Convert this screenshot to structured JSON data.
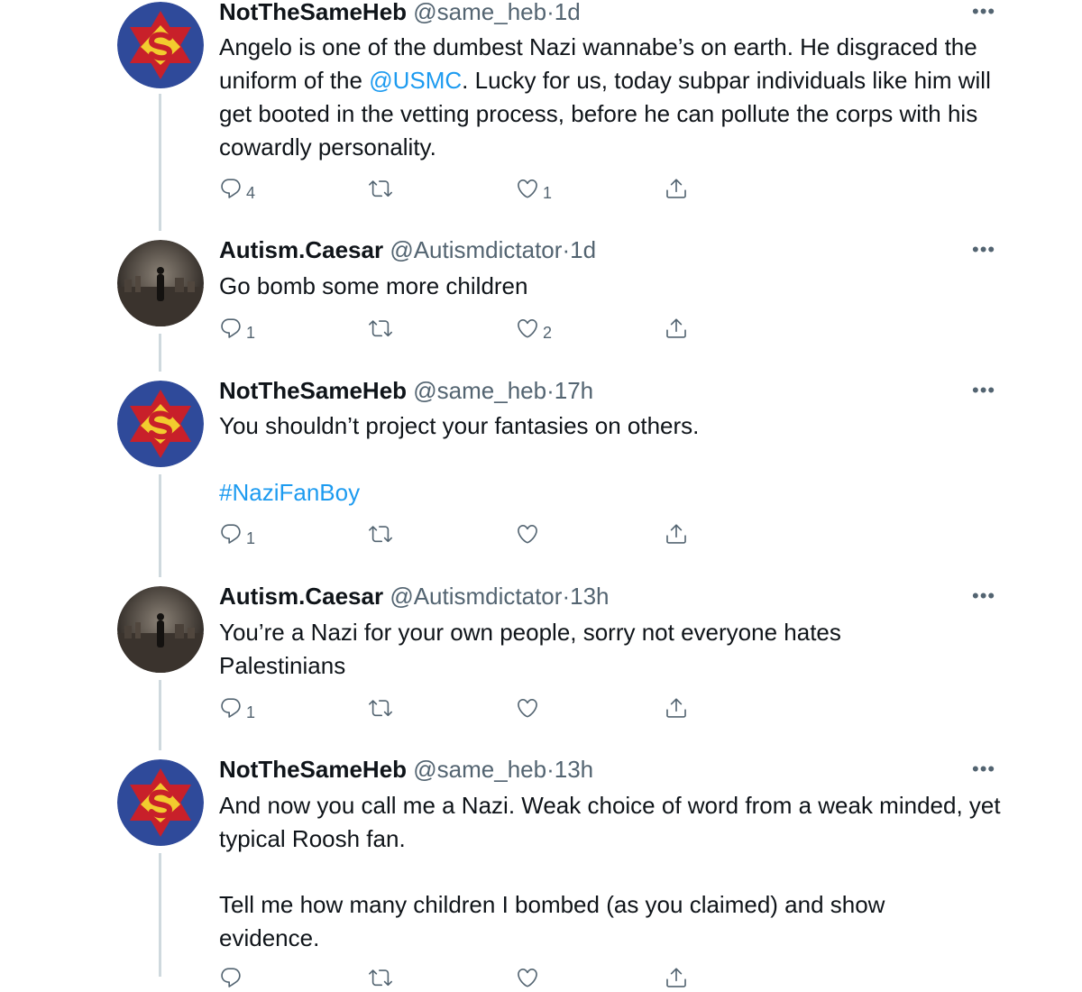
{
  "colors": {
    "link": "#1d9bf0",
    "secondary": "#536471",
    "thread_line": "#cfd9de"
  },
  "tweets": [
    {
      "name": "NotTheSameHeb",
      "handle": "@same_heb",
      "dot": "·",
      "time": "1d",
      "avatar": "superman-star-avatar",
      "text_parts": {
        "a": "Angelo is one of the dumbest Nazi wannabe’s on earth. He disgraced the uniform of the ",
        "mention": "@USMC",
        "b": ". Lucky for us, today subpar individuals like him will get booted in the vetting process, before he can pollute the corps with his cowardly personality."
      },
      "replies": "4",
      "retweets": "",
      "likes": "1"
    },
    {
      "name": "Autism.Caesar",
      "handle": "@Autismdictator",
      "dot": "·",
      "time": "1d",
      "avatar": "city-silhouette-avatar",
      "text": "Go bomb some more children",
      "replies": "1",
      "retweets": "",
      "likes": "2"
    },
    {
      "name": "NotTheSameHeb",
      "handle": "@same_heb",
      "dot": "·",
      "time": "17h",
      "avatar": "superman-star-avatar",
      "text": "You shouldn’t project your fantasies on others.",
      "hashtag": "#NaziFanBoy",
      "replies": "1",
      "retweets": "",
      "likes": ""
    },
    {
      "name": "Autism.Caesar",
      "handle": "@Autismdictator",
      "dot": "·",
      "time": "13h",
      "avatar": "city-silhouette-avatar",
      "text": "You’re a Nazi for your own people, sorry not everyone hates Palestinians",
      "replies": "1",
      "retweets": "",
      "likes": ""
    },
    {
      "name": "NotTheSameHeb",
      "handle": "@same_heb",
      "dot": "·",
      "time": "13h",
      "avatar": "superman-star-avatar",
      "text": "And now you call me a Nazi. Weak choice of word from a weak minded, yet typical Roosh fan.",
      "text2": "Tell me how many children I bombed (as you claimed) and show evidence.",
      "replies": "",
      "retweets": "",
      "likes": ""
    }
  ],
  "more_glyph": "•••"
}
